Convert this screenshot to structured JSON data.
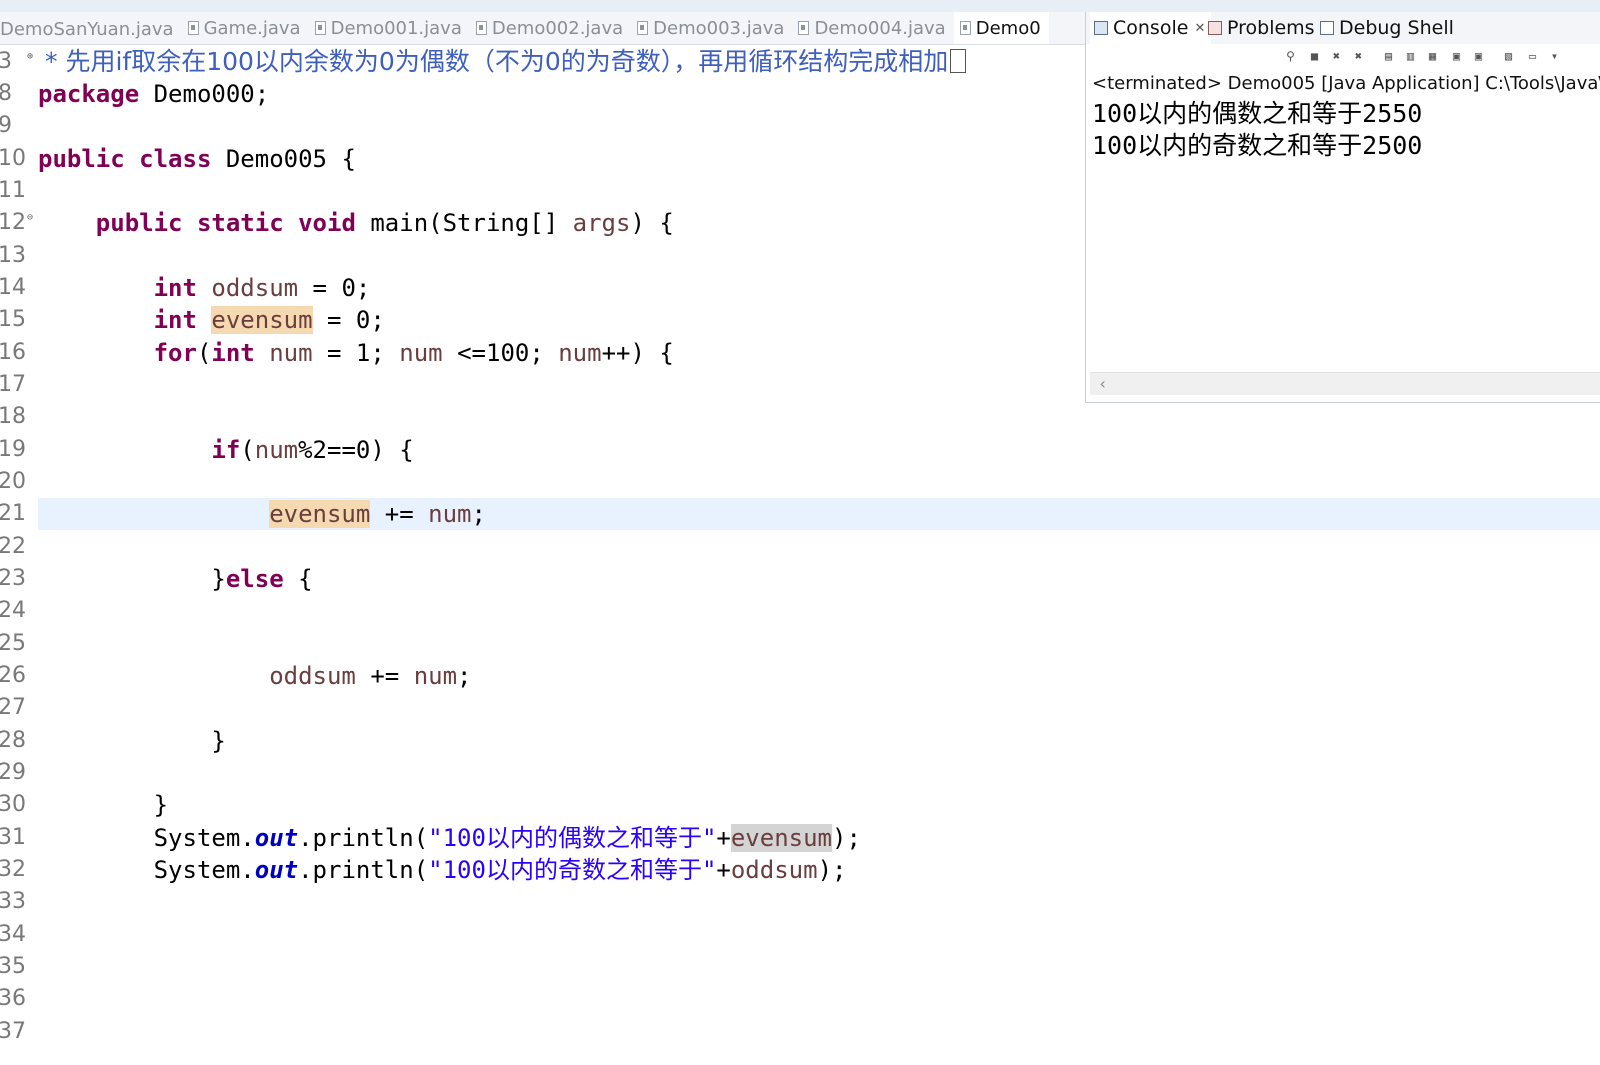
{
  "editor_tabs": [
    {
      "label": "DemoSanYuan.java",
      "active": false
    },
    {
      "label": "Game.java",
      "active": false
    },
    {
      "label": "Demo001.java",
      "active": false
    },
    {
      "label": "Demo002.java",
      "active": false
    },
    {
      "label": "Demo003.java",
      "active": false
    },
    {
      "label": "Demo004.java",
      "active": false
    },
    {
      "label": "Demo0",
      "active": true
    }
  ],
  "line_numbers": [
    "3",
    "8",
    "9",
    "10",
    "11",
    "12",
    "13",
    "14",
    "15",
    "16",
    "17",
    "18",
    "19",
    "20",
    "21",
    "22",
    "23",
    "24",
    "25",
    "26",
    "27",
    "28",
    "29",
    "30",
    "31",
    "32",
    "33",
    "34",
    "35",
    "36",
    "37"
  ],
  "code": {
    "comment": "* 先用if取余在100以内余数为0为偶数（不为0的为奇数），再用循环结构完成相加",
    "l8_kw": "package",
    "l8_rest": " Demo000;",
    "l10_kw1": "public",
    "l10_kw2": "class",
    "l10_rest": " Demo005 {",
    "l12_kw1": "public",
    "l12_kw2": "static",
    "l12_kw3": "void",
    "l12_mid": " main(String[] ",
    "l12_var": "args",
    "l12_end": ") {",
    "l14_kw": "int",
    "l14_var": "oddsum",
    "l14_rest": " = 0;",
    "l15_kw": "int",
    "l15_var": "evensum",
    "l15_rest": " = 0;",
    "l16_kw1": "for",
    "l16_p1": "(",
    "l16_kw2": "int",
    "l16_var1": "num",
    "l16_p2": " = 1; ",
    "l16_var2": "num",
    "l16_p3": " <=100; ",
    "l16_var3": "num",
    "l16_p4": "++) {",
    "l19_kw": "if",
    "l19_p1": "(",
    "l19_var": "num",
    "l19_p2": "%2==0) {",
    "l21_var1": "evensum",
    "l21_p1": " += ",
    "l21_var2": "num",
    "l21_p2": ";",
    "l23_p1": "}",
    "l23_kw": "else",
    "l23_p2": " {",
    "l26_var1": "oddsum",
    "l26_p1": " += ",
    "l26_var2": "num",
    "l26_p2": ";",
    "l28": "}",
    "l30": "}",
    "l31_p1": "System.",
    "l31_static": "out",
    "l31_p2": ".println(",
    "l31_str": "\"100以内的偶数之和等于\"",
    "l31_p3": "+",
    "l31_var": "evensum",
    "l31_p4": ");",
    "l32_p1": "System.",
    "l32_static": "out",
    "l32_p2": ".println(",
    "l32_str": "\"100以内的奇数之和等于\"",
    "l32_p3": "+",
    "l32_var": "oddsum",
    "l32_p4": ");"
  },
  "console": {
    "tabs": [
      {
        "label": "Console",
        "active": true
      },
      {
        "label": "Problems",
        "active": false
      },
      {
        "label": "Debug Shell",
        "active": false
      }
    ],
    "header": "<terminated> Demo005 [Java Application] C:\\Tools\\Java\\",
    "output": [
      "100以内的偶数之和等于2550",
      "100以内的奇数之和等于2500"
    ],
    "toolbar_icons": [
      "pin-icon",
      "terminate-icon",
      "remove-launch-icon",
      "remove-all-icon",
      "scroll-lock-icon",
      "word-wrap-icon",
      "show-on-stdout-icon",
      "show-on-stderr-icon",
      "pin-console-icon",
      "display-console-icon",
      "open-console-icon",
      "view-menu-icon"
    ]
  },
  "colors": {
    "keyword": "#7f0055",
    "variable": "#6a3e3e",
    "string": "#2a00ff",
    "static_field": "#0000c0",
    "comment": "#3f5fbf",
    "occurrence_highlight": "#f5d9b0",
    "current_line": "#e8f2fe"
  }
}
